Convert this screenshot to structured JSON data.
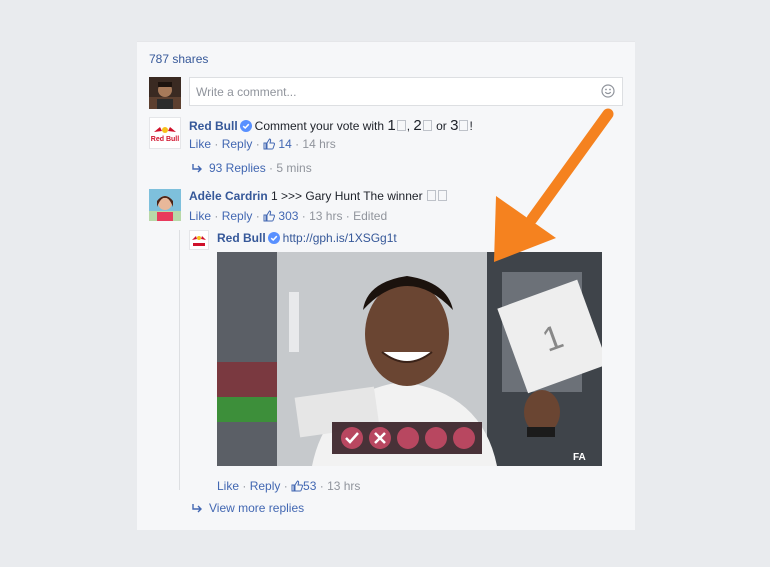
{
  "post": {
    "shares": "787 shares"
  },
  "composer": {
    "placeholder": "Write a comment..."
  },
  "comments": [
    {
      "author": "Red Bull",
      "text_prefix": "Comment your vote with ",
      "vote1": "1",
      "vote2": "2",
      "vote_or": " or ",
      "vote3": "3",
      "text_suffix": "!",
      "sep1": ", ",
      "like": "Like",
      "reply": "Reply",
      "likes": "14",
      "time": "14 hrs",
      "replies_link": "93 Replies",
      "replies_time": "5 mins"
    },
    {
      "author": "Adèle Cardrin",
      "text": "1 >>> Gary Hunt The winner",
      "like": "Like",
      "reply": "Reply",
      "likes": "303",
      "time": "13 hrs",
      "edited": "Edited"
    }
  ],
  "reply": {
    "author": "Red Bull",
    "url": "http://gph.is/1XSGg1t",
    "like": "Like",
    "reply": "Reply",
    "likes": "53",
    "time": "13 hrs",
    "gif_watermark": "FA",
    "card_number": "1"
  },
  "view_more": "View more replies",
  "colors": {
    "link": "#365899",
    "meta": "#90949c",
    "arrow": "#f5821f",
    "background": "#e9ebee",
    "card": "#f6f7f9"
  },
  "icons": [
    "verified-badge-icon",
    "thumbs-up-icon",
    "reply-arrow-icon",
    "emoji-icon",
    "redbull-logo",
    "check-icon",
    "cross-icon"
  ]
}
